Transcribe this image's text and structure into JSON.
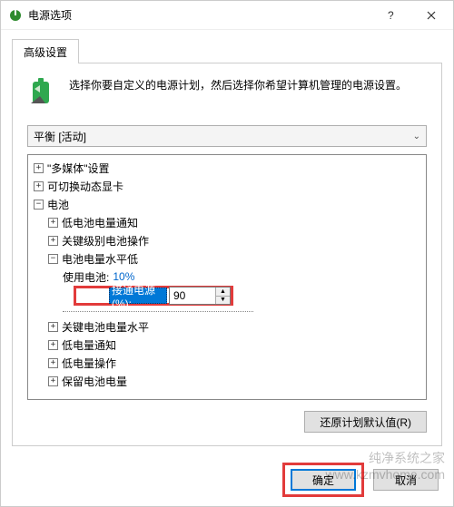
{
  "window": {
    "title": "电源选项"
  },
  "tab": {
    "label": "高级设置"
  },
  "description": "选择你要自定义的电源计划，然后选择你希望计算机管理的电源设置。",
  "plan_select": {
    "value": "平衡 [活动]"
  },
  "tree": {
    "n0": {
      "toggle": "+",
      "label": "\"多媒体\"设置"
    },
    "n1": {
      "toggle": "+",
      "label": "可切换动态显卡"
    },
    "n2": {
      "toggle": "−",
      "label": "电池"
    },
    "n2_0": {
      "toggle": "+",
      "label": "低电池电量通知"
    },
    "n2_1": {
      "toggle": "+",
      "label": "关键级别电池操作"
    },
    "n2_2": {
      "toggle": "−",
      "label": "电池电量水平低"
    },
    "n2_2_0": {
      "label": "使用电池:",
      "value": "10%"
    },
    "n2_2_1": {
      "label": "接通电源(%):",
      "value": "90"
    },
    "n2_3": {
      "toggle": "+",
      "label": "关键电池电量水平"
    },
    "n2_4": {
      "toggle": "+",
      "label": "低电量通知"
    },
    "n2_5": {
      "toggle": "+",
      "label": "低电量操作"
    },
    "n2_6": {
      "toggle": "+",
      "label": "保留电池电量"
    }
  },
  "buttons": {
    "restore": "还原计划默认值(R)",
    "ok": "确定",
    "cancel": "取消"
  },
  "watermark": "纯净系统之家\nwww.kzmvhome.com"
}
